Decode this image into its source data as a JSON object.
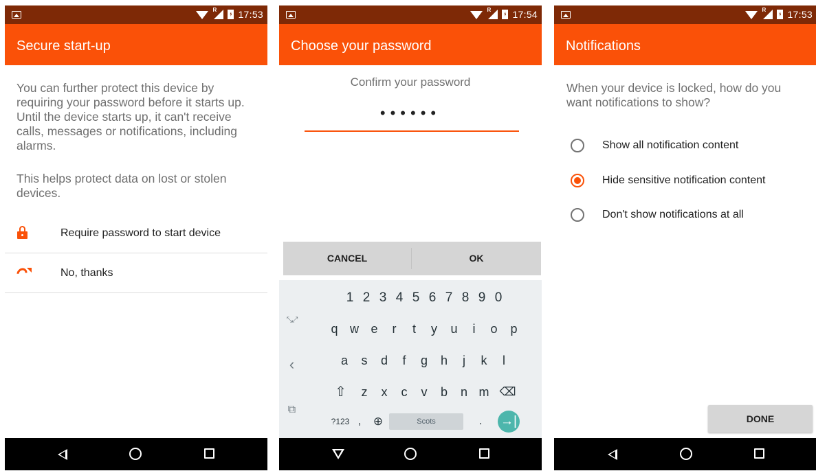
{
  "screens": [
    {
      "status": {
        "time": "17:53",
        "roaming": "R"
      },
      "title": "Secure start-up",
      "paragraph1": "You can further protect this device by requiring your password before it starts up. Until the device starts up, it can't receive calls, messages or notifications, including alarms.",
      "paragraph2": "This helps protect data on lost or stolen devices.",
      "options": [
        {
          "label": "Require password to start device",
          "icon": "lock-icon"
        },
        {
          "label": "No, thanks",
          "icon": "skip-arrow-icon"
        }
      ]
    },
    {
      "status": {
        "time": "17:54",
        "roaming": "R"
      },
      "title": "Choose your password",
      "prompt": "Confirm your password",
      "password_mask": "••••••",
      "cancel_label": "CANCEL",
      "ok_label": "OK",
      "keyboard": {
        "numbers": [
          "1",
          "2",
          "3",
          "4",
          "5",
          "6",
          "7",
          "8",
          "9",
          "0"
        ],
        "row1": [
          "q",
          "w",
          "e",
          "r",
          "t",
          "y",
          "u",
          "i",
          "o",
          "p"
        ],
        "row2": [
          "a",
          "s",
          "d",
          "f",
          "g",
          "h",
          "j",
          "k",
          "l"
        ],
        "row3": [
          "z",
          "x",
          "c",
          "v",
          "b",
          "n",
          "m"
        ],
        "shift": "⇧",
        "backspace": "⌫",
        "symbols": "?123",
        "comma": ",",
        "globe": "⊕",
        "space": "Scots",
        "period": ".",
        "enter": "→|"
      }
    },
    {
      "status": {
        "time": "17:53",
        "roaming": "R"
      },
      "title": "Notifications",
      "question": "When your device is locked, how do you want notifications to show?",
      "options": [
        {
          "label": "Show all notification content",
          "selected": false
        },
        {
          "label": "Hide sensitive notification content",
          "selected": true
        },
        {
          "label": "Don't show notifications at all",
          "selected": false
        }
      ],
      "done_label": "DONE"
    }
  ],
  "colors": {
    "accent": "#fa5108",
    "status_bar": "#7e2906",
    "nav_bar": "#000000",
    "keyboard_enter": "#4db6ac"
  }
}
